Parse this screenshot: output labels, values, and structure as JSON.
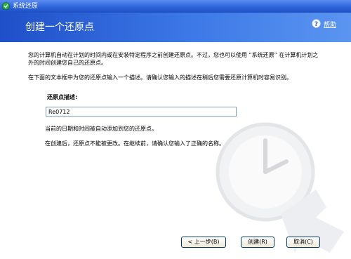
{
  "window": {
    "title": "系统还原"
  },
  "header": {
    "heading": "创建一个还原点",
    "help_label": "帮助"
  },
  "main": {
    "intro": "您的计算机自动在计划的时间内或在安装特定程序之前创建还原点。不过，您也可以使用 “系统还原” 在计算机计划之外的时间创建您自己的还原点。",
    "instruction": "在下面的文本框中为您的还原点输入一个描述。请确认您输入的描述在稍后您需要还原计算机时容易识别。",
    "field_label": "还原点描述:",
    "description_value": "Re0712",
    "date_note": "当前的日期和时间被自动添加到您的还原点。",
    "warning": "在创建后，还原点不能被更改。在继续前，请确认您输入了正确的名称。"
  },
  "buttons": {
    "back": "< 上一步(B)",
    "create": "创建(R)",
    "cancel": "取消(C)"
  },
  "icons": [
    "system-restore-icon",
    "help-icon",
    "clock-watermark-icon"
  ]
}
